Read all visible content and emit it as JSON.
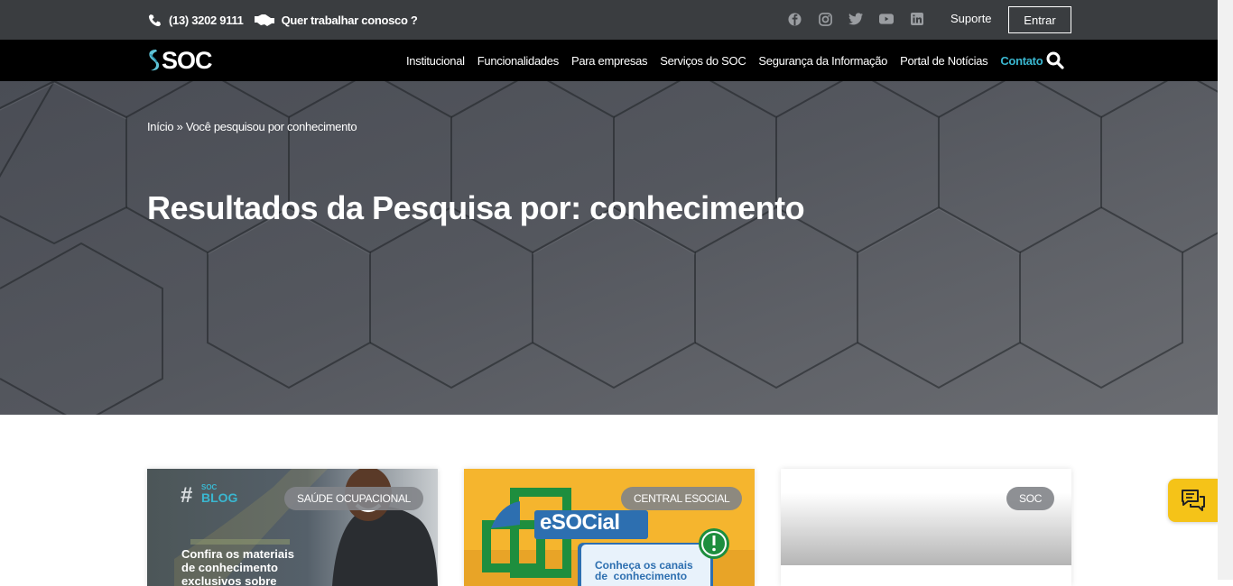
{
  "topbar": {
    "phone": "(13) 3202 9111",
    "work_with_us": "Quer trabalhar conosco ?",
    "support": "Suporte",
    "login": "Entrar"
  },
  "logo": {
    "text": "SOC"
  },
  "nav": {
    "items": [
      "Institucional",
      "Funcionalidades",
      "Para empresas",
      "Serviços do SOC",
      "Segurança da Informação",
      "Portal de Notícias",
      "Contato"
    ],
    "active": "Contato"
  },
  "hero": {
    "breadcrumb_home": "Início",
    "breadcrumb_sep": "»",
    "breadcrumb_current": "Você pesquisou por conhecimento",
    "title": "Resultados da Pesquisa por: conhecimento"
  },
  "cards": [
    {
      "category": "SAÚDE OCUPACIONAL",
      "image_hash": "#",
      "image_brand_small": "SOC",
      "image_brand": "BLOG",
      "image_text_1": "Confira os materiais",
      "image_text_2": "de conhecimento",
      "image_text_3": "exclusivos sobre"
    },
    {
      "category": "CENTRAL ESOCIAL",
      "image_logo": "eSOCial",
      "image_text_1": "Conheça os canais",
      "image_text_2": "de  conhecimento"
    },
    {
      "category": "SOC"
    }
  ],
  "colors": {
    "accent": "#3ab7d0",
    "topbar": "#3a3d40",
    "navbar": "#000000",
    "chat": "#f5c318"
  }
}
